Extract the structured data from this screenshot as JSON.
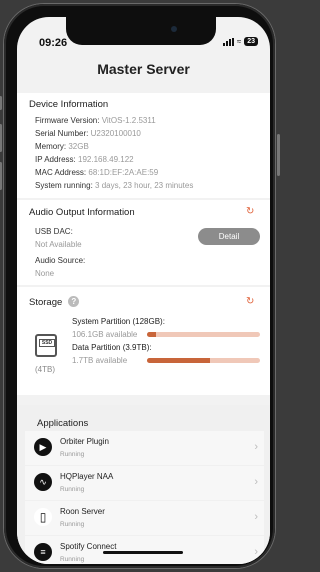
{
  "status": {
    "time": "09:26",
    "battery": "23"
  },
  "title": "Master Server",
  "device": {
    "heading": "Device Information",
    "rows": [
      {
        "label": "Firmware Version:",
        "value": "VitOS-1.2.5311"
      },
      {
        "label": "Serial Number:",
        "value": "U2320100010"
      },
      {
        "label": "Memory:",
        "value": "32GB"
      },
      {
        "label": "IP Address:",
        "value": "192.168.49.122"
      },
      {
        "label": "MAC Address:",
        "value": "68:1D:EF:2A:AE:59"
      },
      {
        "label": "System running:",
        "value": "3 days, 23 hour, 23 minutes"
      }
    ]
  },
  "audio": {
    "heading": "Audio Output Information",
    "usb_label": "USB DAC:",
    "usb_value": "Not Available",
    "source_label": "Audio Source:",
    "source_value": "None",
    "detail_label": "Detail"
  },
  "storage": {
    "heading": "Storage",
    "help": "?",
    "ssd_label": "SSD",
    "capacity": "(4TB)",
    "system_label": "System Partition (128GB):",
    "system_available": "106.1GB available",
    "system_used_fraction": 0.08,
    "data_label": "Data Partition (3.9TB):",
    "data_available": "1.7TB available",
    "data_used_fraction": 0.56
  },
  "applications": {
    "heading": "Applications",
    "items": [
      {
        "name": "Orbiter Plugin",
        "status": "Running"
      },
      {
        "name": "HQPlayer NAA",
        "status": "Running"
      },
      {
        "name": "Roon Server",
        "status": "Running"
      },
      {
        "name": "Spotify Connect",
        "status": "Running"
      }
    ]
  },
  "colors": {
    "accent": "#e0623a",
    "bar_fill": "#c8653a",
    "bar_track": "#f0c8b8"
  }
}
